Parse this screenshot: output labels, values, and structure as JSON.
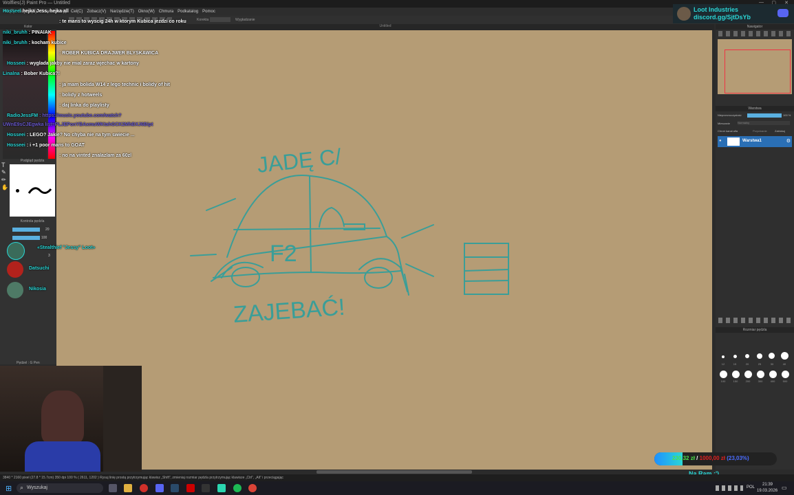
{
  "app": {
    "title": "Wolflies(J) Paint Pro — Untitled",
    "doc_tab": "Untitled",
    "menu": [
      "Plik(F)",
      "Edycja(E)",
      "Odwracanie(I)",
      "Cel(C)",
      "Zobacz(V)",
      "Narzędzie(T)",
      "Okno(W)",
      "Chmura",
      "Podkatalog",
      "Pomoc"
    ],
    "toolbar_hint": "Korekta",
    "toolbar_right": "Wygładzanie",
    "status_text": "3840 * 2160 pixel  (27.8 * 15.7cm)  350 dpi  100 %  ( 2611, 1202 )  Rysuj linię prostą przytrzymując klawisz „Shift”, zmieniaj rozmiar pędzla przytrzymując klawisze „Ctrl”, „Alt” i przeciągając",
    "left_panels": {
      "color_title": "Kolor",
      "brush_preview_title": "Podgląd pędzla",
      "brush_control_title": "Kontrola pędzla",
      "brush_name": "Pędzel : G Pen",
      "size_value": "20",
      "opacity_value": "100",
      "count_value": "3"
    }
  },
  "chat": {
    "lines": [
      {
        "user": "Hosseei",
        "text": "hejka Jess, hejka all",
        "color": "#2bd6d6"
      },
      {
        "user": "",
        "text": ": te mans to wyscig 24h w ktorym Kubica jezdzi co roku",
        "color": "#d33"
      },
      {
        "user": "niki_bruhh",
        "text": ": PINAIAK",
        "color": "#2bd6d6"
      },
      {
        "user": "niki_bruhh",
        "text": ": kocham kubice",
        "color": "#2bd6d6"
      },
      {
        "user": "",
        "text": ": ROBER KUBICA DRAJWER BLYSKAWICA",
        "color": "#d33"
      },
      {
        "user": "Hosseei",
        "text": ": wyglada jakby nie mial zaraz wjechac w kartony",
        "color": "#2bd6d6"
      },
      {
        "user": "Linalna",
        "text": ": Bober Kubica?!",
        "color": "#2bd6d6"
      },
      {
        "user": "",
        "text": ": ja mam bolida W14 z lego technic i bolidy of hit",
        "color": "#d33"
      },
      {
        "user": "",
        "text": ": bolidy z hotweels",
        "color": "#d33"
      },
      {
        "user": "",
        "text": ": daj linka do playlisty",
        "color": "#d33"
      },
      {
        "user": "RadioJessFM",
        "text": ": https://music.youtube.com/watch?",
        "color": "#2bd6d6",
        "link": true
      },
      {
        "user": "",
        "text": "UWnE9sCJEgwka list=PLJEPonYBAxmuWKtahGCK2MhBXJ6Bipt",
        "color": "#6a5acd",
        "link": true
      },
      {
        "user": "Hosseei",
        "text": ": LEGO? Jakie? No chyba nie na tym swiecie ...",
        "color": "#2bd6d6"
      },
      {
        "user": "Hosseei",
        "text": ": i +1 poor mans to GOAT",
        "color": "#2bd6d6"
      },
      {
        "user": "",
        "text": ": no na vinted znalazlam za 60zl",
        "color": "#d33"
      }
    ]
  },
  "viewers": [
    {
      "name": "«Stealthief \"Jessy\" Loot»",
      "color": "#2bd6d6"
    },
    {
      "name": "Datsuchi",
      "color": "#2bd6d6"
    },
    {
      "name": "Nikosia",
      "color": "#2bd6d6"
    }
  ],
  "drawing": {
    "top_text": "JADĘ C/",
    "car_text": "F2",
    "bottom_text": "ZAJEBAĆ!",
    "stroke_color": "#3a9e98"
  },
  "right_panel": {
    "navigator_title": "Nawigator",
    "layer_panel_title": "Warstwa",
    "opacity_label": "Nieprzezroczystość",
    "opacity_value": "100 %",
    "blend_label": "Mieszanie",
    "blend_value": "Normalny",
    "alpha_lock": "Chroń kanał alfa",
    "clipping": "Przycinanie",
    "lock": "Zablokuj",
    "layer_name": "Warstwa1",
    "brush_size_title": "Rozmiar pędzla",
    "brush_size_labels": [
      "12",
      "15",
      "20",
      "25",
      "30",
      "40",
      "100",
      "150",
      "200",
      "300",
      "400",
      "500"
    ]
  },
  "overlay": {
    "loot_title": "Loot Industries",
    "loot_link": "discord.gg/SjtDsYb",
    "donation_current": "230,32 zł",
    "donation_goal": "1000,00 zł",
    "donation_percent": "(23,03%)",
    "donation_fraction": 0.2303,
    "now_playing": "Na Ram :')"
  },
  "taskbar": {
    "search_placeholder": "Wyszukaj",
    "time": "21:39",
    "date": "19.03.2026",
    "lang": "POL"
  },
  "colors": {
    "accent": "#2bd6d6",
    "canvas": "#b59c75",
    "layer_selected": "#2a6fb5"
  }
}
